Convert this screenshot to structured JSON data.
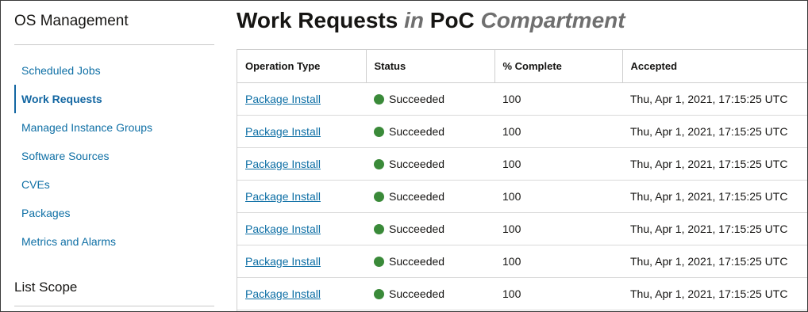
{
  "sidebar": {
    "title": "OS Management",
    "items": [
      {
        "label": "Scheduled Jobs",
        "active": false
      },
      {
        "label": "Work Requests",
        "active": true
      },
      {
        "label": "Managed Instance Groups",
        "active": false
      },
      {
        "label": "Software Sources",
        "active": false
      },
      {
        "label": "CVEs",
        "active": false
      },
      {
        "label": "Packages",
        "active": false
      },
      {
        "label": "Metrics and Alarms",
        "active": false
      }
    ],
    "scope_title": "List Scope"
  },
  "page": {
    "title_main": "Work Requests",
    "title_in": "in",
    "title_name": "PoC",
    "title_scope": "Compartment"
  },
  "table": {
    "columns": [
      "Operation Type",
      "Status",
      "% Complete",
      "Accepted"
    ],
    "status_color": "#3a8a39",
    "rows": [
      {
        "operation": "Package Install",
        "status": "Succeeded",
        "complete": "100",
        "accepted": "Thu, Apr 1, 2021, 17:15:25 UTC"
      },
      {
        "operation": "Package Install",
        "status": "Succeeded",
        "complete": "100",
        "accepted": "Thu, Apr 1, 2021, 17:15:25 UTC"
      },
      {
        "operation": "Package Install",
        "status": "Succeeded",
        "complete": "100",
        "accepted": "Thu, Apr 1, 2021, 17:15:25 UTC"
      },
      {
        "operation": "Package Install",
        "status": "Succeeded",
        "complete": "100",
        "accepted": "Thu, Apr 1, 2021, 17:15:25 UTC"
      },
      {
        "operation": "Package Install",
        "status": "Succeeded",
        "complete": "100",
        "accepted": "Thu, Apr 1, 2021, 17:15:25 UTC"
      },
      {
        "operation": "Package Install",
        "status": "Succeeded",
        "complete": "100",
        "accepted": "Thu, Apr 1, 2021, 17:15:25 UTC"
      },
      {
        "operation": "Package Install",
        "status": "Succeeded",
        "complete": "100",
        "accepted": "Thu, Apr 1, 2021, 17:15:25 UTC"
      }
    ]
  }
}
